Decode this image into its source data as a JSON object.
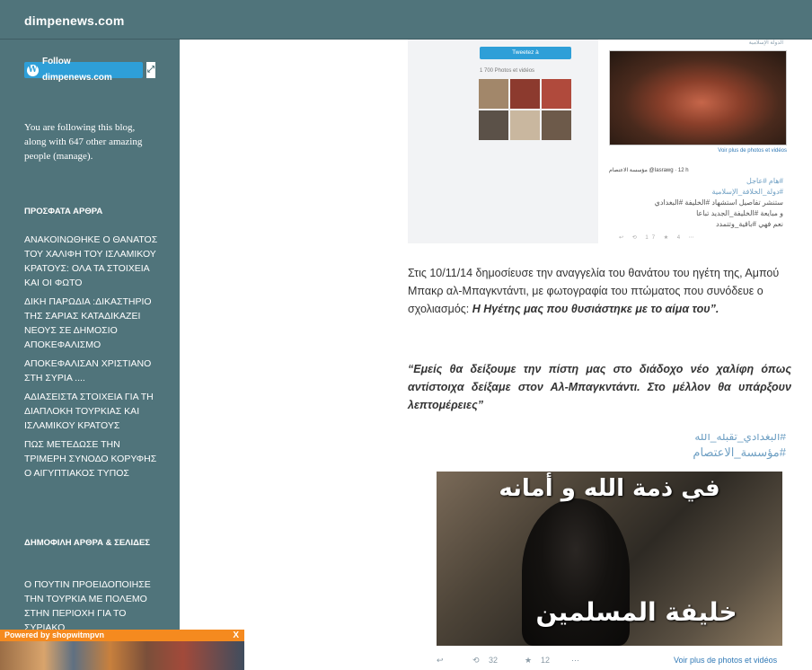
{
  "header": {
    "site_title": "dimpenews.com"
  },
  "sidebar": {
    "follow_label": "Follow dimpenews.com",
    "follow_text": "You are following this blog, along with 647 other amazing people (manage).",
    "recent_heading": "ΠΡΟΣΦΑΤΑ ΑΡΘΡΑ",
    "recent": [
      "ΑΝΑΚΟΙΝΩΘΗΚΕ Ο ΘΑΝΑΤΟΣ ΤΟΥ ΧΑΛΙΦΗ ΤΟΥ ΙΣΛΑΜΙΚΟΥ ΚΡΑΤΟΥΣ: ΟΛΑ ΤΑ ΣΤΟΙΧΕΙΑ ΚΑΙ ΟΙ ΦΩΤΟ",
      "ΔΙΚΗ ΠΑΡΩΔΙΑ :ΔΙΚΑΣΤΗΡΙΟ ΤΗΣ ΣΑΡΙΑΣ ΚΑΤΑΔΙΚΑΖΕΙ ΝΕΟΥΣ ΣΕ ΔΗΜΟΣΙΟ ΑΠΟΚΕΦΑΛΙΣΜΟ",
      "ΑΠΟΚΕΦΑΛΙΣΑΝ ΧΡΙΣΤΙΑΝΟ ΣΤΗ ΣΥΡΙΑ ....",
      "ΑΔΙΑΣΕΙΣΤΑ ΣΤΟΙΧΕΙΑ ΓΙΑ ΤΗ ΔΙΑΠΛΟΚΗ ΤΟΥΡΚΙΑΣ ΚΑΙ ΙΣΛΑΜΙΚΟΥ ΚΡΑΤΟΥΣ",
      "ΠΩΣ ΜΕΤΕΔΩΣΕ ΤΗΝ ΤΡΙΜΕΡΗ ΣΥΝΟΔΟ ΚΟΡΥΦΗΣ Ο ΑΙΓΥΠΤΙΑΚΟΣ ΤΥΠΟΣ"
    ],
    "popular_heading": "ΔΗΜΟΦΙΛΗ ΑΡΘΡΑ & ΣΕΛΙΔΕΣ",
    "popular": [
      "Ο ΠΟΥΤΙΝ ΠΡΟΕΙΔΟΠΟΙΗΣΕ ΤΗΝ ΤΟΥΡΚΙΑ ΜΕ ΠΟΛΕΜΟ ΣΤΗΝ ΠΕΡΙΟΧΗ ΓΙΑ ΤΟ ΣΥΡΙΑΚΟ"
    ]
  },
  "ad": {
    "label": "Powered by shopwitmpvn",
    "close": "X"
  },
  "embed1": {
    "tweet_button": "Tweetez à",
    "photos_count": "1 700 Photos et vidéos",
    "top_arabic": "الدولة الإسلامية",
    "voir": "Voir plus de photos et vidéos",
    "tweet_author": "مؤسسة الاعتصام @Iasrawg · 12 h",
    "arabic_lines": [
      "#هام #عاجل",
      "#دولة_الخلافة_الإسلامية",
      "ستنشر تفاصيل استشهاد #الخليفة #البغدادي",
      "و مبايعة #الخليفة_الجديد تباعا",
      "نعم فهي #باقية_وتتمدد"
    ],
    "actions": "↩ ⟲ 17 ★ 4 ⋯"
  },
  "article": {
    "para_text": " Στις 10/11/14 δημοσίευσε την αναγγελία του θανάτου  του ηγέτη της, Αμπού Μπακρ αλ-Μπαγκντάντι, με φωτογραφία του πτώματος που συνόδευε ο σχολιασμός: ",
    "para_bold": "Η Ηγέτης μας που θυσιάστηκε με το αίμα του”.",
    "quote": "“Εμείς θα δείξουμε  την πίστη μας στο διάδοχο νέο χαλίφη όπως αντίστοιχα δείξαμε στον Αλ-Μπαγκντάντι. Στο μέλλον θα υπάρξουν λεπτομέρειες”"
  },
  "embed2": {
    "tag_top": "#البغدادي_تقبله_الله",
    "tag": "#مؤسسة_الاعتصام",
    "caption_top": "في ذمة الله و أمانه",
    "caption_bottom": "خليفة المسلمين",
    "reply": "↩",
    "retweet_count": "32",
    "fav_count": "12",
    "more": "⋯",
    "voir": "Voir plus de photos et vidéos"
  }
}
